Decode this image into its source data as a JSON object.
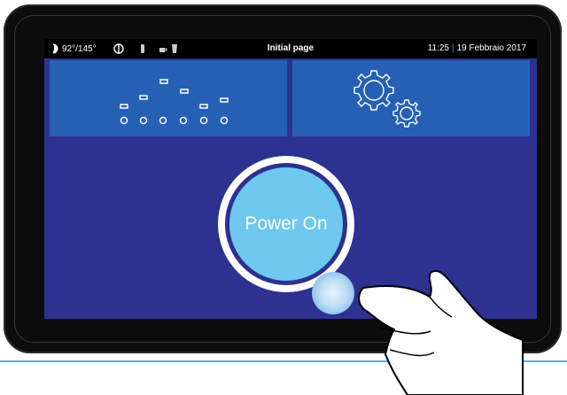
{
  "status_bar": {
    "temperature": "92°/145°",
    "page_title": "Initial page",
    "time": "11:25",
    "separator": "|",
    "date": "19 Febbraio 2017"
  },
  "tiles": {
    "programs": {
      "icon": "program-dots-icon"
    },
    "settings": {
      "icon": "gears-icon"
    }
  },
  "power_button": {
    "label": "Power On"
  },
  "colors": {
    "screen_bg": "#2d3190",
    "tile_bg": "#2660b5",
    "power_fill": "#6ec8ef",
    "accent": "#3a8fe0"
  }
}
